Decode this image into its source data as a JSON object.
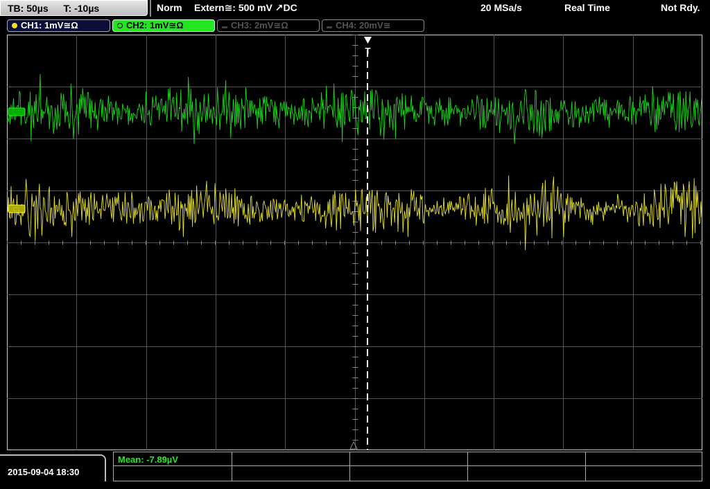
{
  "top": {
    "timebase": "TB: 50µs",
    "trigger_time": "T: -10µs",
    "trigger_mode": "Norm",
    "trigger_source": "Extern≅: 500 mV ↗DC",
    "sample_rate": "20 MSa/s",
    "acq_mode": "Real Time",
    "status": "Not Rdy."
  },
  "channels": [
    {
      "label": "CH1: 1mV≅Ω",
      "color": "#f0e020",
      "active": true
    },
    {
      "label": "CH2: 1mV≅Ω",
      "color": "#21e621",
      "active": true
    },
    {
      "label": "CH3: 2mV≅Ω",
      "color": "#555555",
      "active": false
    },
    {
      "label": "CH4: 20mV≅",
      "color": "#555555",
      "active": false
    }
  ],
  "markers": {
    "trigger": "T",
    "ch1": "C1",
    "ch2": "C2"
  },
  "bottom": {
    "datetime": "2015-09-04 18:30",
    "measurement": "Mean: -7.89µV"
  },
  "colors": {
    "ch1": "#e6e02a",
    "ch2": "#18d818",
    "grid": "#555555",
    "trigger_line": "#ffffff"
  }
}
